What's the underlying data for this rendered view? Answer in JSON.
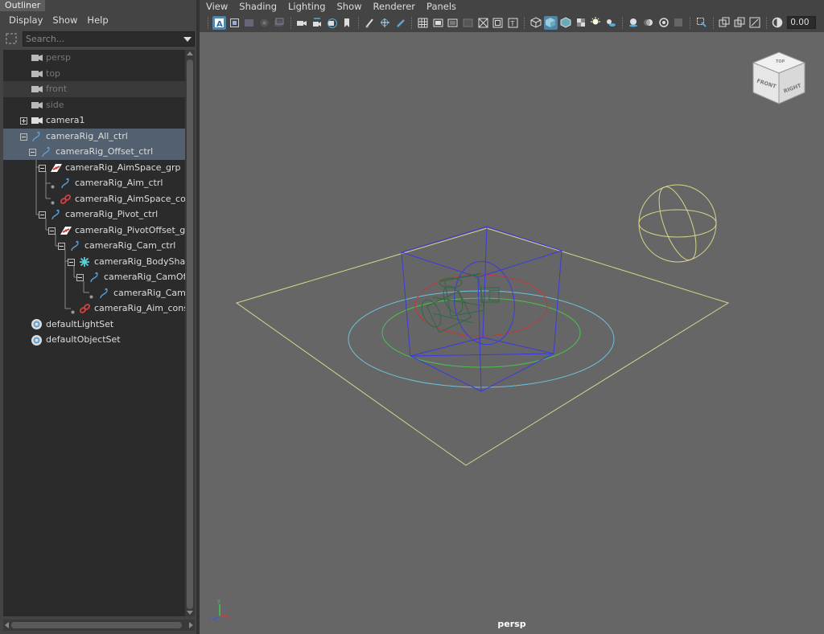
{
  "outliner": {
    "tab_title": "Outliner",
    "menu": [
      "Display",
      "Show",
      "Help"
    ],
    "search": {
      "placeholder": "Search..."
    },
    "items": [
      {
        "label": "persp",
        "icon": "camera-icon",
        "depth": 1,
        "state": "dim"
      },
      {
        "label": "top",
        "icon": "camera-icon",
        "depth": 1,
        "state": "dim"
      },
      {
        "label": "front",
        "icon": "camera-icon",
        "depth": 1,
        "state": "dim"
      },
      {
        "label": "side",
        "icon": "camera-icon",
        "depth": 1,
        "state": "dim"
      },
      {
        "label": "camera1",
        "icon": "camera-icon",
        "depth": 1,
        "state": "normal"
      },
      {
        "label": "cameraRig_All_ctrl",
        "icon": "curve-icon",
        "depth": 1,
        "state": "selected"
      },
      {
        "label": "cameraRig_Offset_ctrl",
        "icon": "curve-icon",
        "depth": 2,
        "state": "selected"
      },
      {
        "label": "cameraRig_AimSpace_grp",
        "icon": "transform-icon",
        "depth": 3,
        "state": "normal"
      },
      {
        "label": "cameraRig_Aim_ctrl",
        "icon": "curve-icon",
        "depth": 4,
        "state": "normal"
      },
      {
        "label": "cameraRig_AimSpace_constra",
        "icon": "constraint-icon",
        "depth": 4,
        "state": "normal"
      },
      {
        "label": "cameraRig_Pivot_ctrl",
        "icon": "curve-icon",
        "depth": 3,
        "state": "normal"
      },
      {
        "label": "cameraRig_PivotOffset_grp",
        "icon": "transform-icon",
        "depth": 4,
        "state": "normal"
      },
      {
        "label": "cameraRig_Cam_ctrl",
        "icon": "curve-icon",
        "depth": 5,
        "state": "normal"
      },
      {
        "label": "cameraRig_BodyShake_l",
        "icon": "locator-icon",
        "depth": 6,
        "state": "normal"
      },
      {
        "label": "cameraRig_CamOffset",
        "icon": "curve-icon",
        "depth": 7,
        "state": "normal"
      },
      {
        "label": "cameraRig_CamRol",
        "icon": "curve-icon",
        "depth": 8,
        "state": "normal"
      },
      {
        "label": "cameraRig_Aim_constrai",
        "icon": "constraint-icon",
        "depth": 6,
        "state": "normal"
      },
      {
        "label": "defaultLightSet",
        "icon": "set-icon",
        "depth": 0,
        "state": "normal"
      },
      {
        "label": "defaultObjectSet",
        "icon": "set-icon",
        "depth": 0,
        "state": "normal"
      }
    ]
  },
  "viewport": {
    "menu": [
      "View",
      "Shading",
      "Lighting",
      "Show",
      "Renderer",
      "Panels"
    ],
    "exposure": "0.00",
    "camera_name": "persp",
    "viewcube": {
      "top": "TOP",
      "front": "FRONT",
      "right": "RIGHT"
    },
    "axis": {
      "x": "x",
      "y": "y",
      "z": "z"
    }
  },
  "colors": {
    "selection": "#52606f",
    "active_tool": "#5285a6",
    "grid_plane": "#d8d48a",
    "rig_box": "#3a3ae0",
    "ring_cyan": "#6ec3dc",
    "ring_green": "#4cc24c",
    "ring_red": "#c23838",
    "constraint_red": "#d24040",
    "curve_blue": "#5aa0d8"
  }
}
